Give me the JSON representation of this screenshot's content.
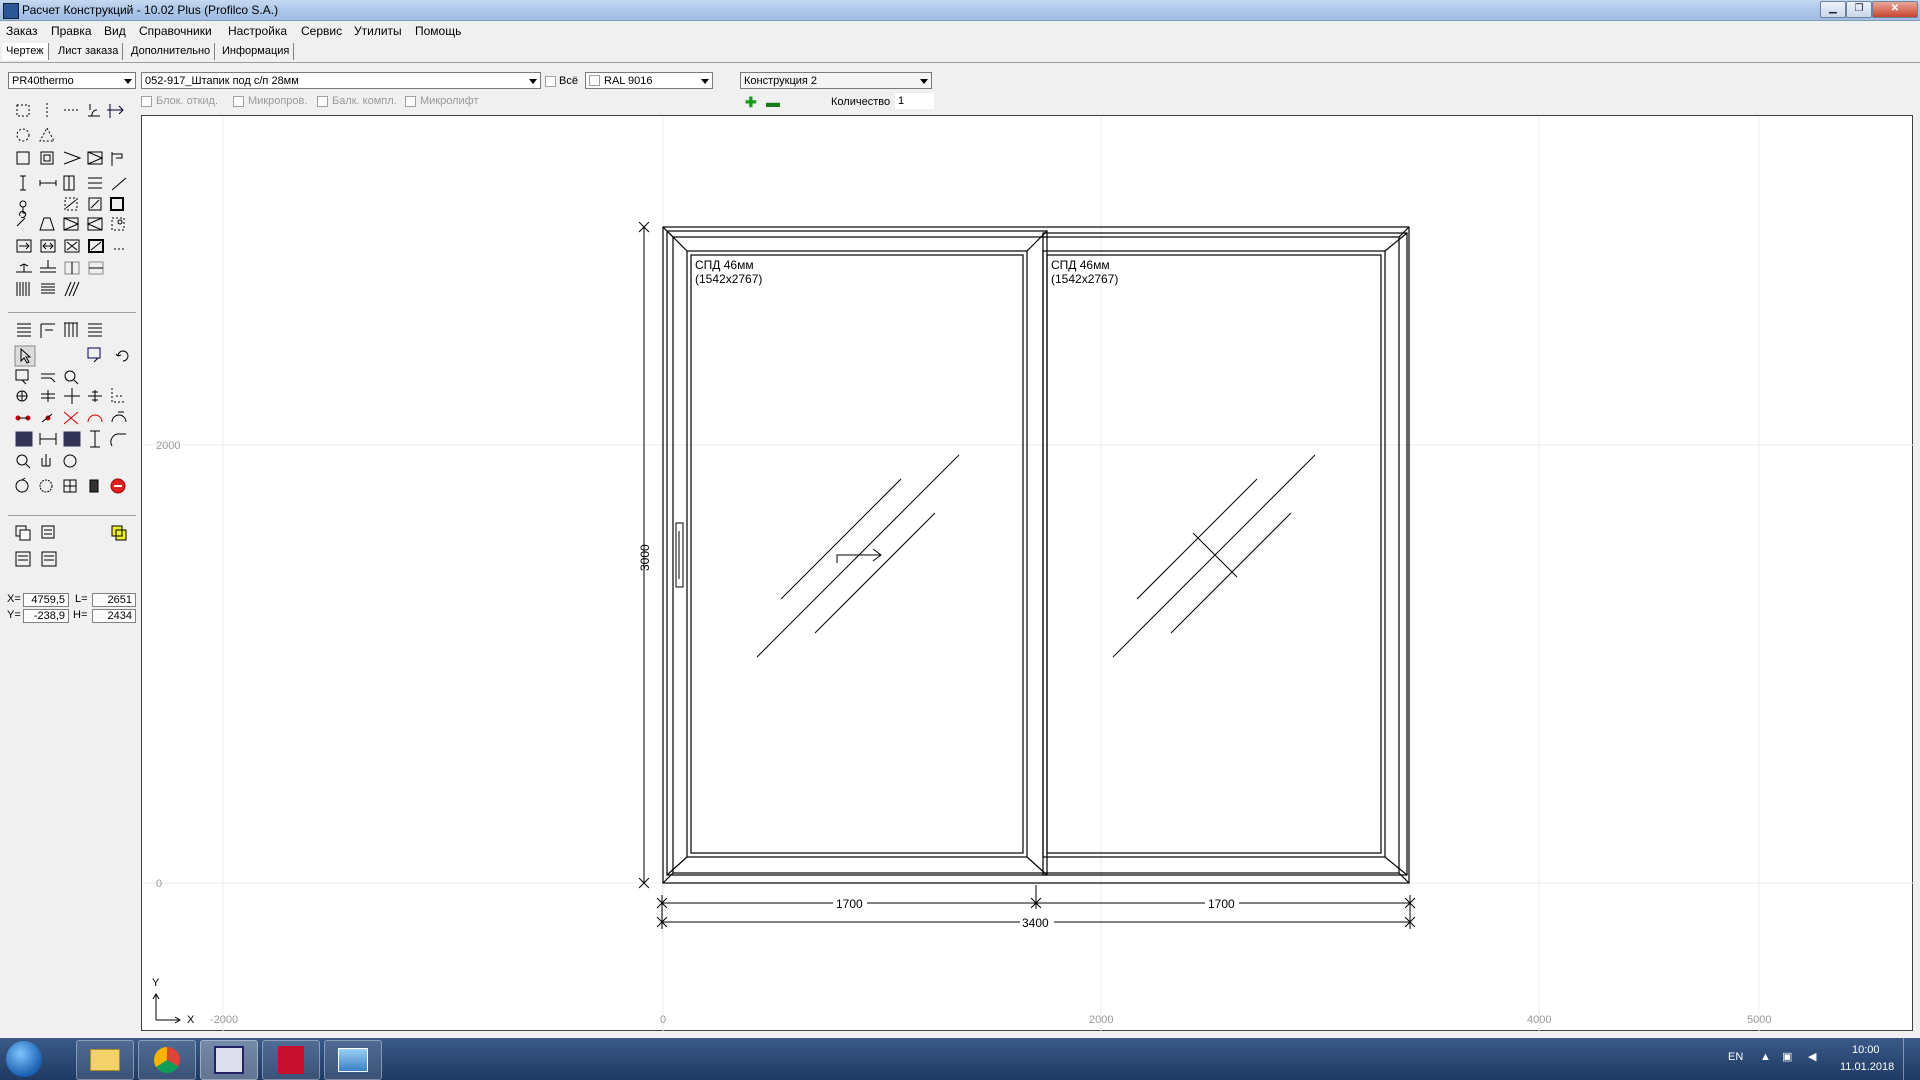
{
  "window": {
    "title": "Расчет Конструкций - 10.02 Plus (Profilco S.A.)"
  },
  "menu": [
    "Заказ",
    "Правка",
    "Вид",
    "Справочники",
    "Настройка",
    "Сервис",
    "Утилиты",
    "Помощь"
  ],
  "tabs": [
    "Чертеж",
    "Лист заказа",
    "Дополнительно",
    "Информация"
  ],
  "toolbar": {
    "profile_system": "PR40thermo",
    "glazing_bead": "052-917_Штапик под с/п 28мм",
    "all_label": "Всё",
    "color": "RAL 9016",
    "construction": "Конструкция 2",
    "quantity_label": "Количество",
    "quantity_value": "1",
    "options": [
      "Блок. откид.",
      "Микропров.",
      "Балк. компл.",
      "Микролифт"
    ]
  },
  "coords": {
    "x_label": "X=",
    "x_value": "4759,5",
    "y_label": "Y=",
    "y_value": "-238,9",
    "l_label": "L=",
    "l_value": "2651",
    "h_label": "H=",
    "h_value": "2434"
  },
  "drawing": {
    "sash_left_label": "СПД 46мм",
    "sash_left_size": "(1542x2767)",
    "sash_right_label": "СПД 46мм",
    "sash_right_size": "(1542x2767)",
    "dim_left": "1700",
    "dim_right": "1700",
    "dim_total": "3400",
    "dim_height": "3000",
    "grid_x_labels": [
      "-2000",
      "0",
      "2000",
      "4000",
      "5000"
    ],
    "grid_y_labels": [
      "2000",
      "0"
    ],
    "axis_x": "X",
    "axis_y": "Y"
  },
  "tray": {
    "lang": "EN",
    "time": "10:00",
    "date": "11.01.2018"
  }
}
